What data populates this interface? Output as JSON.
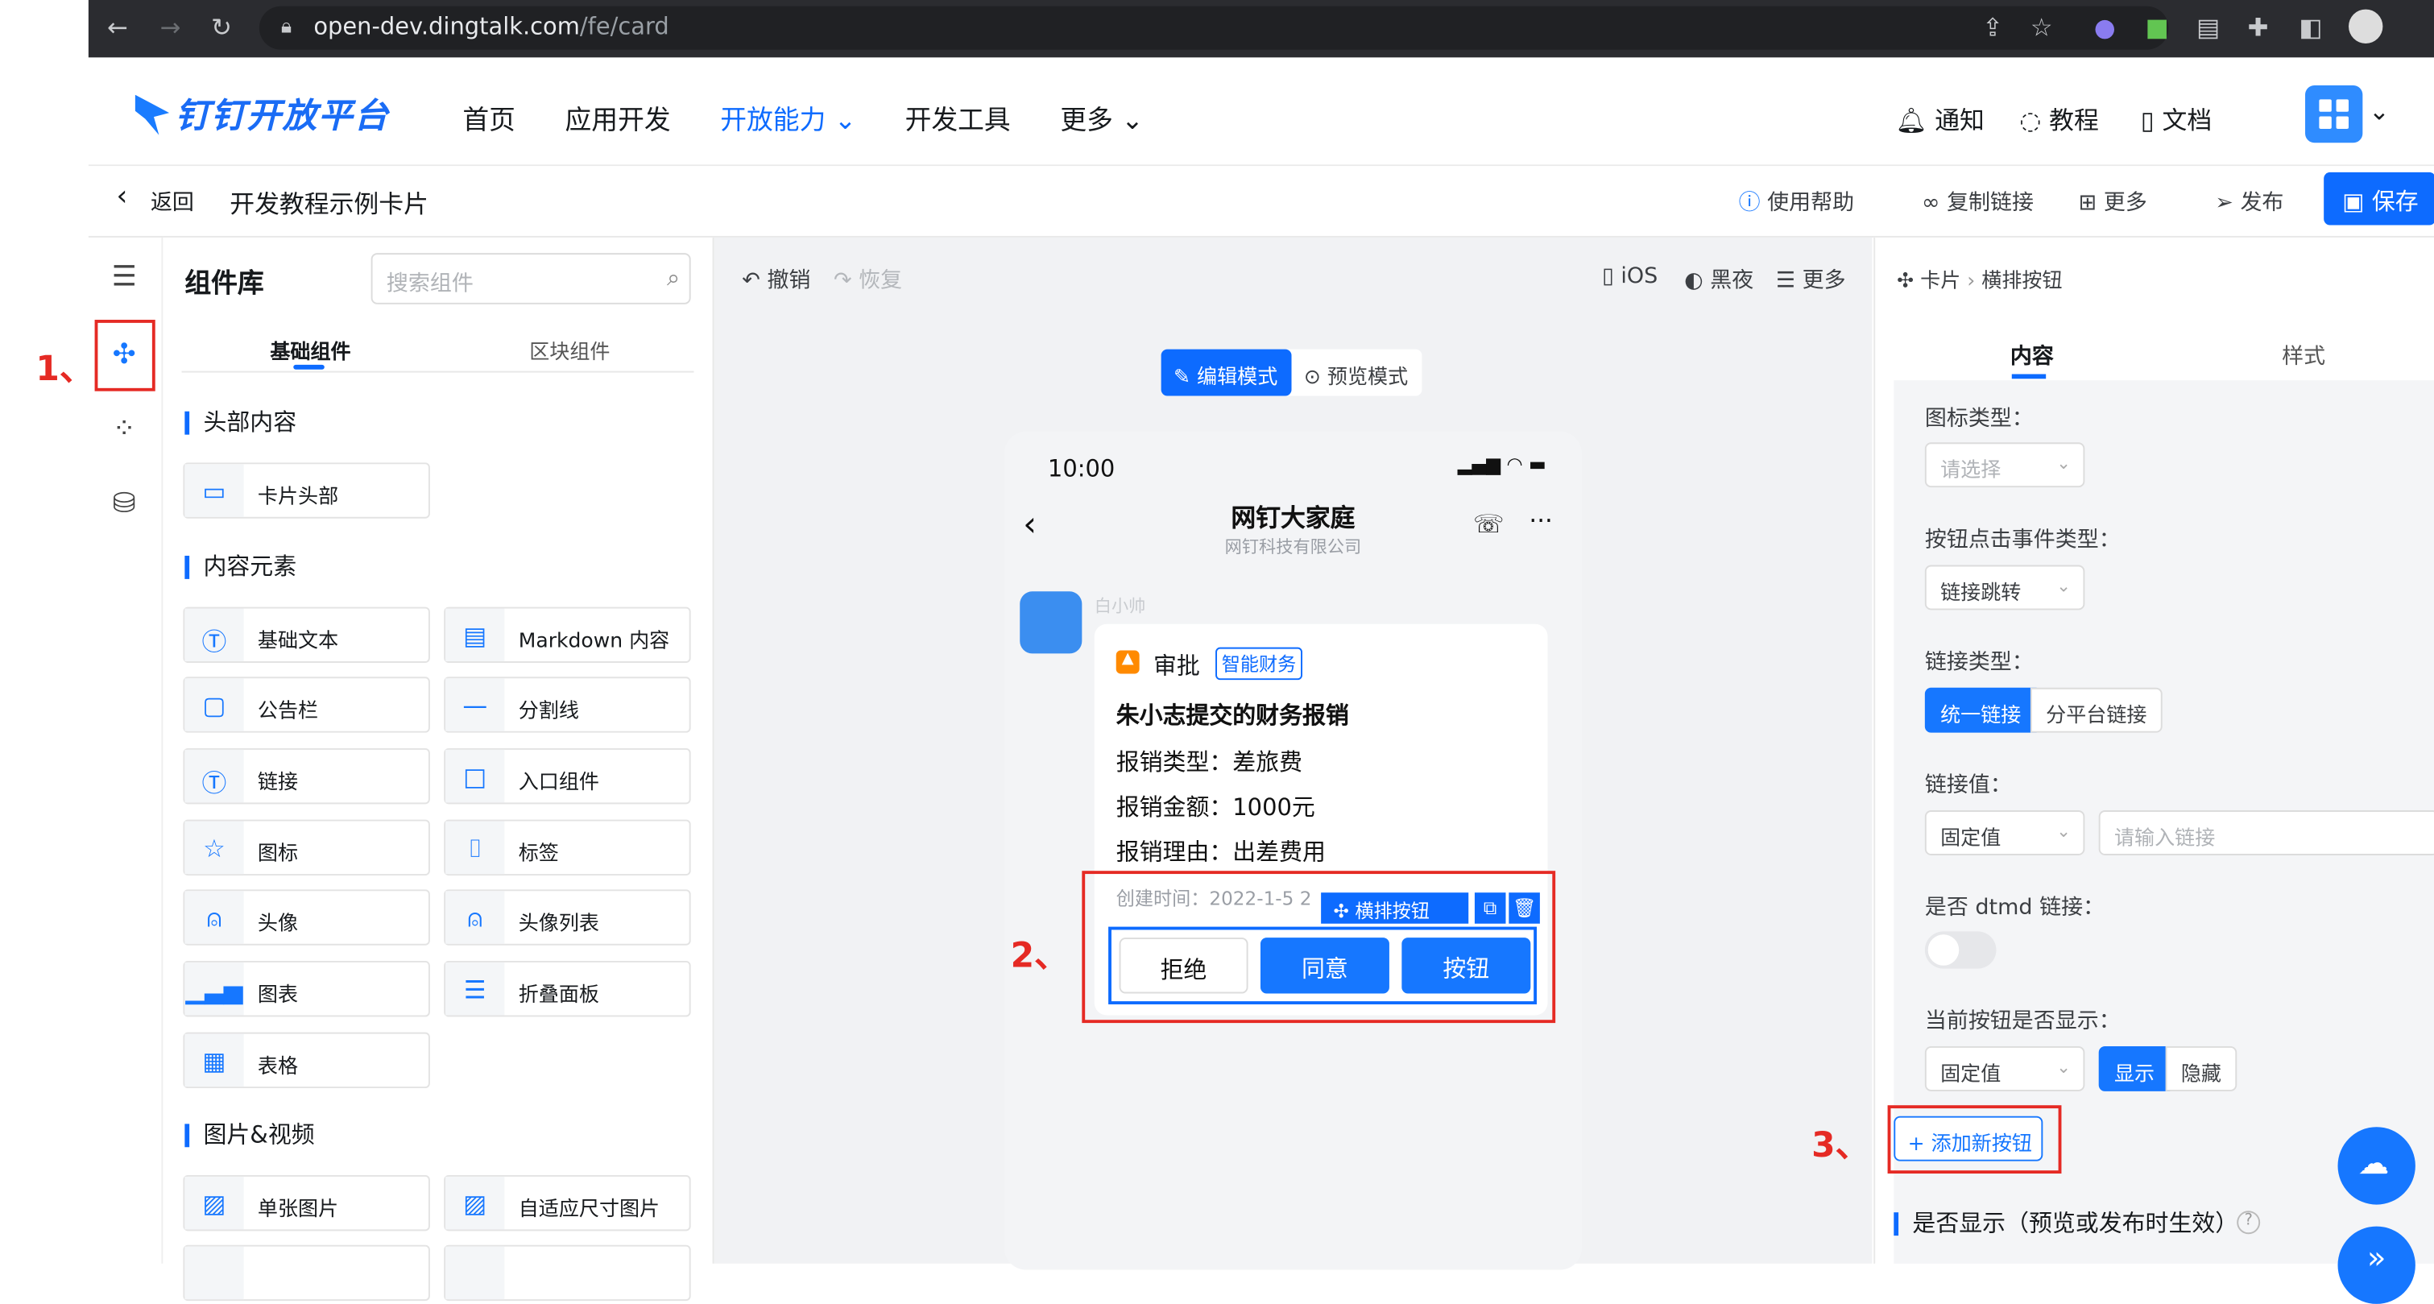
{
  "browser": {
    "url_host": "open-dev.dingtalk.com",
    "url_path": "/fe/card"
  },
  "nav": {
    "brand": "钉钉开放平台",
    "items": [
      "首页",
      "应用开发",
      "开放能力",
      "开发工具",
      "更多"
    ],
    "notify": "通知",
    "tutorial": "教程",
    "docs": "文档"
  },
  "subbar": {
    "back": "返回",
    "title": "开发教程示例卡片",
    "help": "使用帮助",
    "copy_link": "复制链接",
    "more": "更多",
    "publish": "发布",
    "save": "保存"
  },
  "annotations": {
    "one": "1、",
    "two": "2、",
    "three": "3、"
  },
  "library": {
    "title": "组件库",
    "search_placeholder": "搜索组件",
    "tabs": [
      "基础组件",
      "区块组件"
    ],
    "sections": {
      "header": "头部内容",
      "content": "内容元素",
      "media": "图片&视频"
    },
    "header_items": [
      "卡片头部"
    ],
    "content_items": [
      "基础文本",
      "Markdown 内容",
      "公告栏",
      "分割线",
      "链接",
      "入口组件",
      "图标",
      "标签",
      "头像",
      "头像列表",
      "图表",
      "折叠面板",
      "表格"
    ],
    "media_items": [
      "单张图片",
      "自适应尺寸图片"
    ]
  },
  "canvas": {
    "undo": "撤销",
    "redo": "恢复",
    "ios": "iOS",
    "night": "黑夜",
    "more": "更多",
    "mode_edit": "编辑模式",
    "mode_preview": "预览模式"
  },
  "phone": {
    "time": "10:00",
    "chat_title": "网钉大家庭",
    "chat_sub": "网钉科技有限公司",
    "sender": "白小帅",
    "card_title": "审批",
    "tag": "智能财务",
    "heading": "朱小志提交的财务报销",
    "lines": [
      "报销类型：差旅费",
      "报销金额：1000元",
      "报销理由：出差费用"
    ],
    "created": "创建时间：2022-1-5 2",
    "selection_label": "横排按钮",
    "buttons": [
      "拒绝",
      "同意",
      "按钮"
    ]
  },
  "props": {
    "breadcrumb_root": "卡片",
    "breadcrumb_current": "横排按钮",
    "tabs": [
      "内容",
      "样式"
    ],
    "icon_type_label": "图标类型：",
    "icon_type_placeholder": "请选择",
    "event_type_label": "按钮点击事件类型：",
    "event_type_value": "链接跳转",
    "link_type_label": "链接类型：",
    "link_type_options": [
      "统一链接",
      "分平台链接"
    ],
    "link_value_label": "链接值：",
    "link_value_mode": "固定值",
    "link_value_placeholder": "请输入链接",
    "dtmd_label": "是否 dtmd 链接：",
    "show_label": "当前按钮是否显示：",
    "show_mode": "固定值",
    "show_options": [
      "显示",
      "隐藏"
    ],
    "add_button": "添加新按钮",
    "visible_section": "是否显示（预览或发布时生效）"
  },
  "colors": {
    "accent": "#0d6bff",
    "annotation": "#e52a24"
  }
}
